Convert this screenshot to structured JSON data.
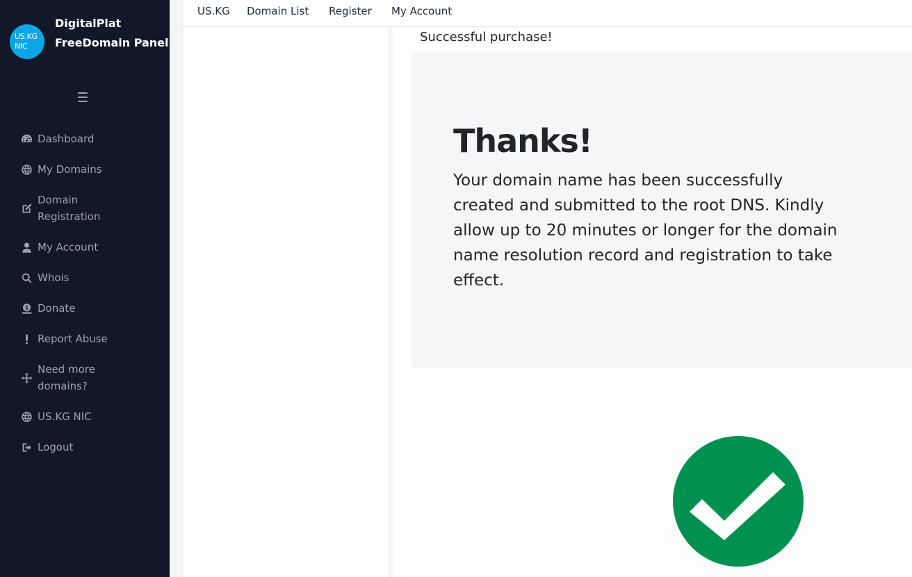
{
  "sidebar": {
    "logo_line1": "US.KG",
    "logo_line2": "NIC",
    "brand_title": "DigitalPlat FreeDomain Panel",
    "menu_icon": "hamburger-icon",
    "items": [
      {
        "label": "Dashboard",
        "icon": "dashboard-icon"
      },
      {
        "label": "My Domains",
        "icon": "globe-icon"
      },
      {
        "label": "Domain Registration",
        "icon": "edit-icon"
      },
      {
        "label": "My Account",
        "icon": "user-icon"
      },
      {
        "label": "Whois",
        "icon": "search-icon"
      },
      {
        "label": "Donate",
        "icon": "donate-icon"
      },
      {
        "label": "Report Abuse",
        "icon": "exclamation-icon"
      },
      {
        "label": "Need more domains?",
        "icon": "arrows-icon"
      },
      {
        "label": "US.KG NIC",
        "icon": "globe-icon"
      },
      {
        "label": "Logout",
        "icon": "logout-icon"
      }
    ]
  },
  "topnav": {
    "items": [
      "US.KG",
      "Domain List",
      "Register",
      "My Account"
    ]
  },
  "main": {
    "success_message": "Successful purchase!",
    "thanks_heading": "Thanks!",
    "thanks_body": "Your domain name has been successfully created and submitted to the root DNS. Kindly allow up to 20 minutes or longer for the domain name resolution record and registration to take effect.",
    "check_icon": "checkmark-icon"
  },
  "colors": {
    "sidebar_bg": "#111827",
    "logo_bg": "#0ea5e9",
    "check_green": "#009150"
  }
}
